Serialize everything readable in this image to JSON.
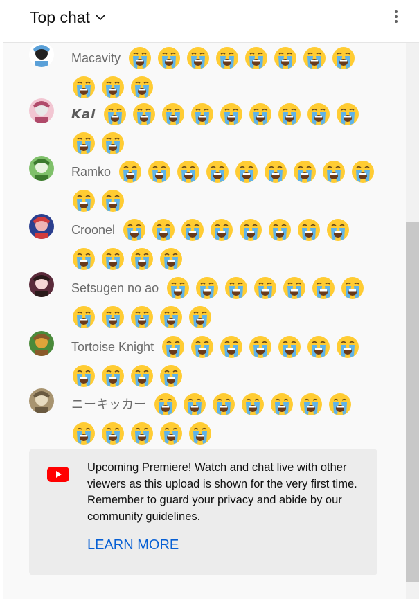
{
  "header": {
    "title": "Top chat"
  },
  "messages": [
    {
      "author": "Macavity",
      "emoji_count": 11,
      "style": "normal",
      "avatar": "avatar-macavity"
    },
    {
      "author": "𝙆𝙖𝙞",
      "emoji_count": 11,
      "style": "bold-italic",
      "avatar": "avatar-kai"
    },
    {
      "author": "Ramko",
      "emoji_count": 11,
      "style": "normal",
      "avatar": "avatar-ramko"
    },
    {
      "author": "Croonel",
      "emoji_count": 12,
      "style": "normal",
      "avatar": "avatar-croonel"
    },
    {
      "author": "Setsugen no ao",
      "emoji_count": 12,
      "style": "normal",
      "avatar": "avatar-setsugen"
    },
    {
      "author": "Tortoise Knight",
      "emoji_count": 11,
      "style": "normal",
      "avatar": "avatar-tortoise"
    },
    {
      "author": "ニーキッカー",
      "emoji_count": 12,
      "style": "normal",
      "avatar": "avatar-nikicker"
    }
  ],
  "emoji": {
    "name": "loudly-crying-face-icon"
  },
  "banner": {
    "text": "Upcoming Premiere! Watch and chat live with other viewers as this upload is shown for the very first time. Remember to guard your privacy and abide by our community guidelines.",
    "learn_more": "LEARN MORE",
    "icon": "youtube-logo-icon"
  },
  "colors": {
    "accent": "#065fd4",
    "youtube_red": "#ff0000"
  }
}
